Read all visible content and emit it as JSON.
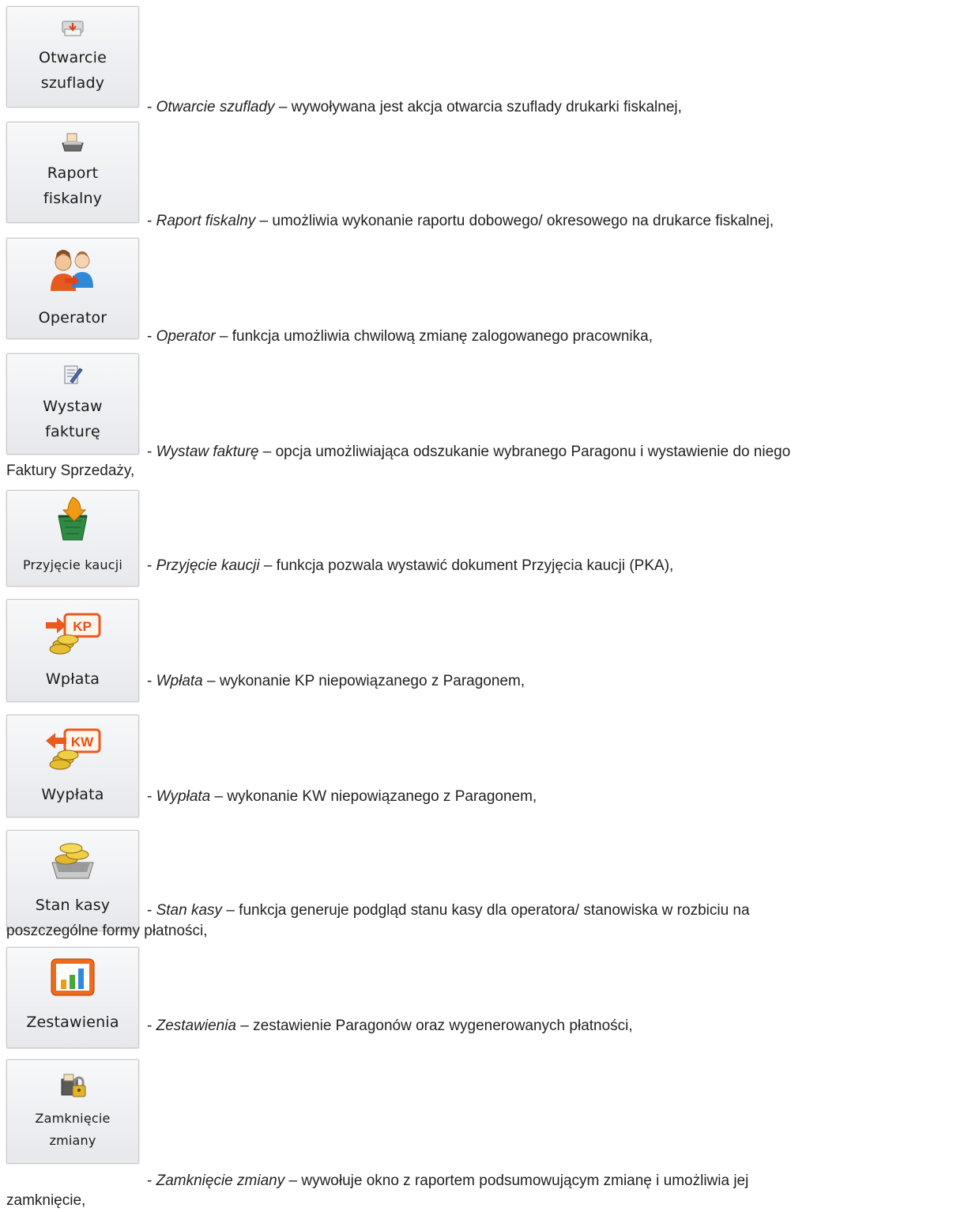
{
  "items": [
    {
      "label_lines": [
        "Otwarcie",
        "szuflady"
      ],
      "name": "Otwarcie szuflady",
      "text": " – wywoływana jest akcja otwarcia szuflady drukarki fiskalnej,",
      "icon": "drawer-open-icon"
    },
    {
      "label_lines": [
        "Raport",
        "fiskalny"
      ],
      "name": "Raport fiskalny",
      "text": " – umożliwia wykonanie raportu dobowego/ okresowego na drukarce fiskalnej,",
      "icon": "fiscal-printer-icon"
    },
    {
      "label_lines": [
        "Operator"
      ],
      "name": "Operator",
      "text": " – funkcja umożliwia chwilową zmianę zalogowanego pracownika,",
      "icon": "operator-switch-icon"
    },
    {
      "label_lines": [
        "Wystaw",
        "fakturę"
      ],
      "name": "Wystaw fakturę",
      "text": " – opcja umożliwiająca odszukanie wybranego Paragonu i wystawienie do niego",
      "continuation": "Faktury Sprzedaży,",
      "icon": "invoice-pen-icon"
    },
    {
      "label_lines": [
        "Przyjęcie kaucji"
      ],
      "name": "Przyjęcie kaucji",
      "text": " – funkcja pozwala wystawić dokument Przyjęcia kaucji (PKA),",
      "icon": "deposit-crate-icon"
    },
    {
      "label_lines": [
        "Wpłata"
      ],
      "name": "Wpłata",
      "text": " – wykonanie KP niepowiązanego z Paragonem,",
      "icon": "kp-coins-icon",
      "badge": "KP"
    },
    {
      "label_lines": [
        "Wypłata"
      ],
      "name": "Wypłata",
      "text": " – wykonanie KW niepowiązanego z Paragonem,",
      "icon": "kw-coins-icon",
      "badge": "KW"
    },
    {
      "label_lines": [
        "Stan kasy"
      ],
      "name": "Stan kasy",
      "text": " – funkcja generuje podgląd stanu kasy dla operatora/ stanowiska w rozbiciu na",
      "continuation": "poszczególne formy płatności,",
      "icon": "cash-drawer-coins-icon"
    },
    {
      "label_lines": [
        "Zestawienia"
      ],
      "name": "Zestawienia",
      "text": " – zestawienie  Paragonów oraz wygenerowanych płatności,",
      "icon": "bar-chart-icon"
    },
    {
      "label_lines": [
        "Zamknięcie",
        "zmiany"
      ],
      "name": "Zamknięcie zmiany",
      "text": " – wywołuje okno z raportem podsumowującym zmianę i umożliwia jej",
      "continuation": "zamknięcie,",
      "icon": "register-lock-icon"
    }
  ],
  "dash": "- "
}
